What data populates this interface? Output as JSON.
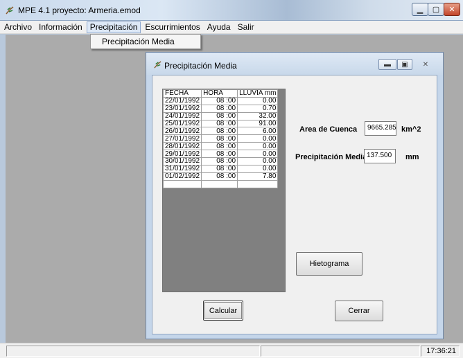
{
  "app": {
    "title": "MPE 4.1 proyecto: Armeria.emod"
  },
  "menubar": {
    "items": [
      "Archivo",
      "Información",
      "Precipitación",
      "Escurrimientos",
      "Ayuda",
      "Salir"
    ],
    "active_index": 2
  },
  "dropdown": {
    "items": [
      "Precipitación Media"
    ]
  },
  "child_window": {
    "title": "Precipitación Media",
    "grid": {
      "headers": [
        "FECHA",
        "HORA",
        "LLUVIA mm"
      ],
      "rows": [
        [
          "22/01/1992",
          "08 :00",
          "0.00"
        ],
        [
          "23/01/1992",
          "08 :00",
          "0.70"
        ],
        [
          "24/01/1992",
          "08 :00",
          "32.00"
        ],
        [
          "25/01/1992",
          "08 :00",
          "91.00"
        ],
        [
          "26/01/1992",
          "08 :00",
          "6.00"
        ],
        [
          "27/01/1992",
          "08 :00",
          "0.00"
        ],
        [
          "28/01/1992",
          "08 :00",
          "0.00"
        ],
        [
          "29/01/1992",
          "08 :00",
          "0.00"
        ],
        [
          "30/01/1992",
          "08 :00",
          "0.00"
        ],
        [
          "31/01/1992",
          "08 :00",
          "0.00"
        ],
        [
          "01/02/1992",
          "08 :00",
          "7.80"
        ],
        [
          "",
          "",
          ""
        ]
      ]
    },
    "area_label": "Area de Cuenca",
    "area_value": "9665.285",
    "area_unit": "km^2",
    "precip_label": "Precipitación Media",
    "precip_value": "137.500",
    "precip_unit": "mm",
    "hietograma_button": "Hietograma",
    "calcular_button": "Calcular",
    "cerrar_button": "Cerrar"
  },
  "statusbar": {
    "time": "17:36:21"
  }
}
